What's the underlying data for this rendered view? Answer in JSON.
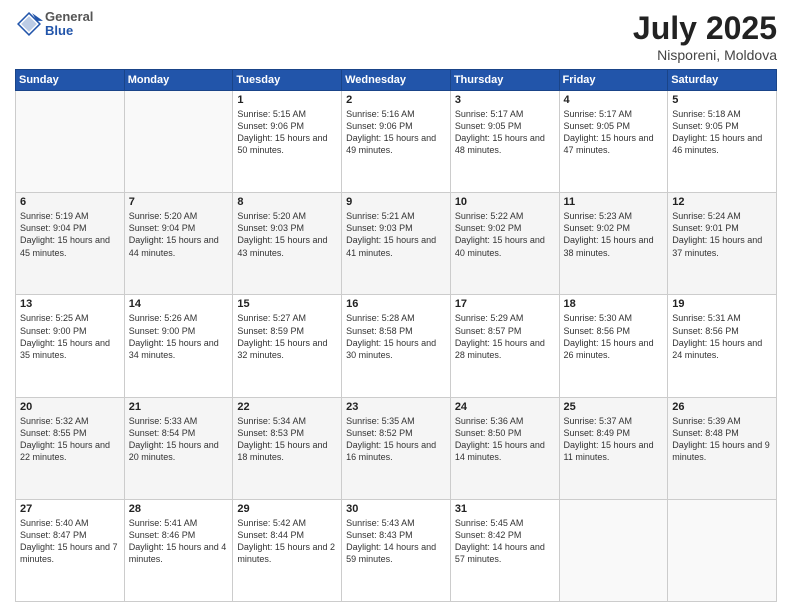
{
  "header": {
    "logo_general": "General",
    "logo_blue": "Blue",
    "main_title": "July 2025",
    "subtitle": "Nisporeni, Moldova"
  },
  "days_of_week": [
    "Sunday",
    "Monday",
    "Tuesday",
    "Wednesday",
    "Thursday",
    "Friday",
    "Saturday"
  ],
  "weeks": [
    {
      "cells": [
        {
          "empty": true
        },
        {
          "empty": true
        },
        {
          "day": "1",
          "sunrise": "Sunrise: 5:15 AM",
          "sunset": "Sunset: 9:06 PM",
          "daylight": "Daylight: 15 hours and 50 minutes."
        },
        {
          "day": "2",
          "sunrise": "Sunrise: 5:16 AM",
          "sunset": "Sunset: 9:06 PM",
          "daylight": "Daylight: 15 hours and 49 minutes."
        },
        {
          "day": "3",
          "sunrise": "Sunrise: 5:17 AM",
          "sunset": "Sunset: 9:05 PM",
          "daylight": "Daylight: 15 hours and 48 minutes."
        },
        {
          "day": "4",
          "sunrise": "Sunrise: 5:17 AM",
          "sunset": "Sunset: 9:05 PM",
          "daylight": "Daylight: 15 hours and 47 minutes."
        },
        {
          "day": "5",
          "sunrise": "Sunrise: 5:18 AM",
          "sunset": "Sunset: 9:05 PM",
          "daylight": "Daylight: 15 hours and 46 minutes."
        }
      ]
    },
    {
      "cells": [
        {
          "day": "6",
          "sunrise": "Sunrise: 5:19 AM",
          "sunset": "Sunset: 9:04 PM",
          "daylight": "Daylight: 15 hours and 45 minutes."
        },
        {
          "day": "7",
          "sunrise": "Sunrise: 5:20 AM",
          "sunset": "Sunset: 9:04 PM",
          "daylight": "Daylight: 15 hours and 44 minutes."
        },
        {
          "day": "8",
          "sunrise": "Sunrise: 5:20 AM",
          "sunset": "Sunset: 9:03 PM",
          "daylight": "Daylight: 15 hours and 43 minutes."
        },
        {
          "day": "9",
          "sunrise": "Sunrise: 5:21 AM",
          "sunset": "Sunset: 9:03 PM",
          "daylight": "Daylight: 15 hours and 41 minutes."
        },
        {
          "day": "10",
          "sunrise": "Sunrise: 5:22 AM",
          "sunset": "Sunset: 9:02 PM",
          "daylight": "Daylight: 15 hours and 40 minutes."
        },
        {
          "day": "11",
          "sunrise": "Sunrise: 5:23 AM",
          "sunset": "Sunset: 9:02 PM",
          "daylight": "Daylight: 15 hours and 38 minutes."
        },
        {
          "day": "12",
          "sunrise": "Sunrise: 5:24 AM",
          "sunset": "Sunset: 9:01 PM",
          "daylight": "Daylight: 15 hours and 37 minutes."
        }
      ]
    },
    {
      "cells": [
        {
          "day": "13",
          "sunrise": "Sunrise: 5:25 AM",
          "sunset": "Sunset: 9:00 PM",
          "daylight": "Daylight: 15 hours and 35 minutes."
        },
        {
          "day": "14",
          "sunrise": "Sunrise: 5:26 AM",
          "sunset": "Sunset: 9:00 PM",
          "daylight": "Daylight: 15 hours and 34 minutes."
        },
        {
          "day": "15",
          "sunrise": "Sunrise: 5:27 AM",
          "sunset": "Sunset: 8:59 PM",
          "daylight": "Daylight: 15 hours and 32 minutes."
        },
        {
          "day": "16",
          "sunrise": "Sunrise: 5:28 AM",
          "sunset": "Sunset: 8:58 PM",
          "daylight": "Daylight: 15 hours and 30 minutes."
        },
        {
          "day": "17",
          "sunrise": "Sunrise: 5:29 AM",
          "sunset": "Sunset: 8:57 PM",
          "daylight": "Daylight: 15 hours and 28 minutes."
        },
        {
          "day": "18",
          "sunrise": "Sunrise: 5:30 AM",
          "sunset": "Sunset: 8:56 PM",
          "daylight": "Daylight: 15 hours and 26 minutes."
        },
        {
          "day": "19",
          "sunrise": "Sunrise: 5:31 AM",
          "sunset": "Sunset: 8:56 PM",
          "daylight": "Daylight: 15 hours and 24 minutes."
        }
      ]
    },
    {
      "cells": [
        {
          "day": "20",
          "sunrise": "Sunrise: 5:32 AM",
          "sunset": "Sunset: 8:55 PM",
          "daylight": "Daylight: 15 hours and 22 minutes."
        },
        {
          "day": "21",
          "sunrise": "Sunrise: 5:33 AM",
          "sunset": "Sunset: 8:54 PM",
          "daylight": "Daylight: 15 hours and 20 minutes."
        },
        {
          "day": "22",
          "sunrise": "Sunrise: 5:34 AM",
          "sunset": "Sunset: 8:53 PM",
          "daylight": "Daylight: 15 hours and 18 minutes."
        },
        {
          "day": "23",
          "sunrise": "Sunrise: 5:35 AM",
          "sunset": "Sunset: 8:52 PM",
          "daylight": "Daylight: 15 hours and 16 minutes."
        },
        {
          "day": "24",
          "sunrise": "Sunrise: 5:36 AM",
          "sunset": "Sunset: 8:50 PM",
          "daylight": "Daylight: 15 hours and 14 minutes."
        },
        {
          "day": "25",
          "sunrise": "Sunrise: 5:37 AM",
          "sunset": "Sunset: 8:49 PM",
          "daylight": "Daylight: 15 hours and 11 minutes."
        },
        {
          "day": "26",
          "sunrise": "Sunrise: 5:39 AM",
          "sunset": "Sunset: 8:48 PM",
          "daylight": "Daylight: 15 hours and 9 minutes."
        }
      ]
    },
    {
      "cells": [
        {
          "day": "27",
          "sunrise": "Sunrise: 5:40 AM",
          "sunset": "Sunset: 8:47 PM",
          "daylight": "Daylight: 15 hours and 7 minutes."
        },
        {
          "day": "28",
          "sunrise": "Sunrise: 5:41 AM",
          "sunset": "Sunset: 8:46 PM",
          "daylight": "Daylight: 15 hours and 4 minutes."
        },
        {
          "day": "29",
          "sunrise": "Sunrise: 5:42 AM",
          "sunset": "Sunset: 8:44 PM",
          "daylight": "Daylight: 15 hours and 2 minutes."
        },
        {
          "day": "30",
          "sunrise": "Sunrise: 5:43 AM",
          "sunset": "Sunset: 8:43 PM",
          "daylight": "Daylight: 14 hours and 59 minutes."
        },
        {
          "day": "31",
          "sunrise": "Sunrise: 5:45 AM",
          "sunset": "Sunset: 8:42 PM",
          "daylight": "Daylight: 14 hours and 57 minutes."
        },
        {
          "empty": true
        },
        {
          "empty": true
        }
      ]
    }
  ]
}
